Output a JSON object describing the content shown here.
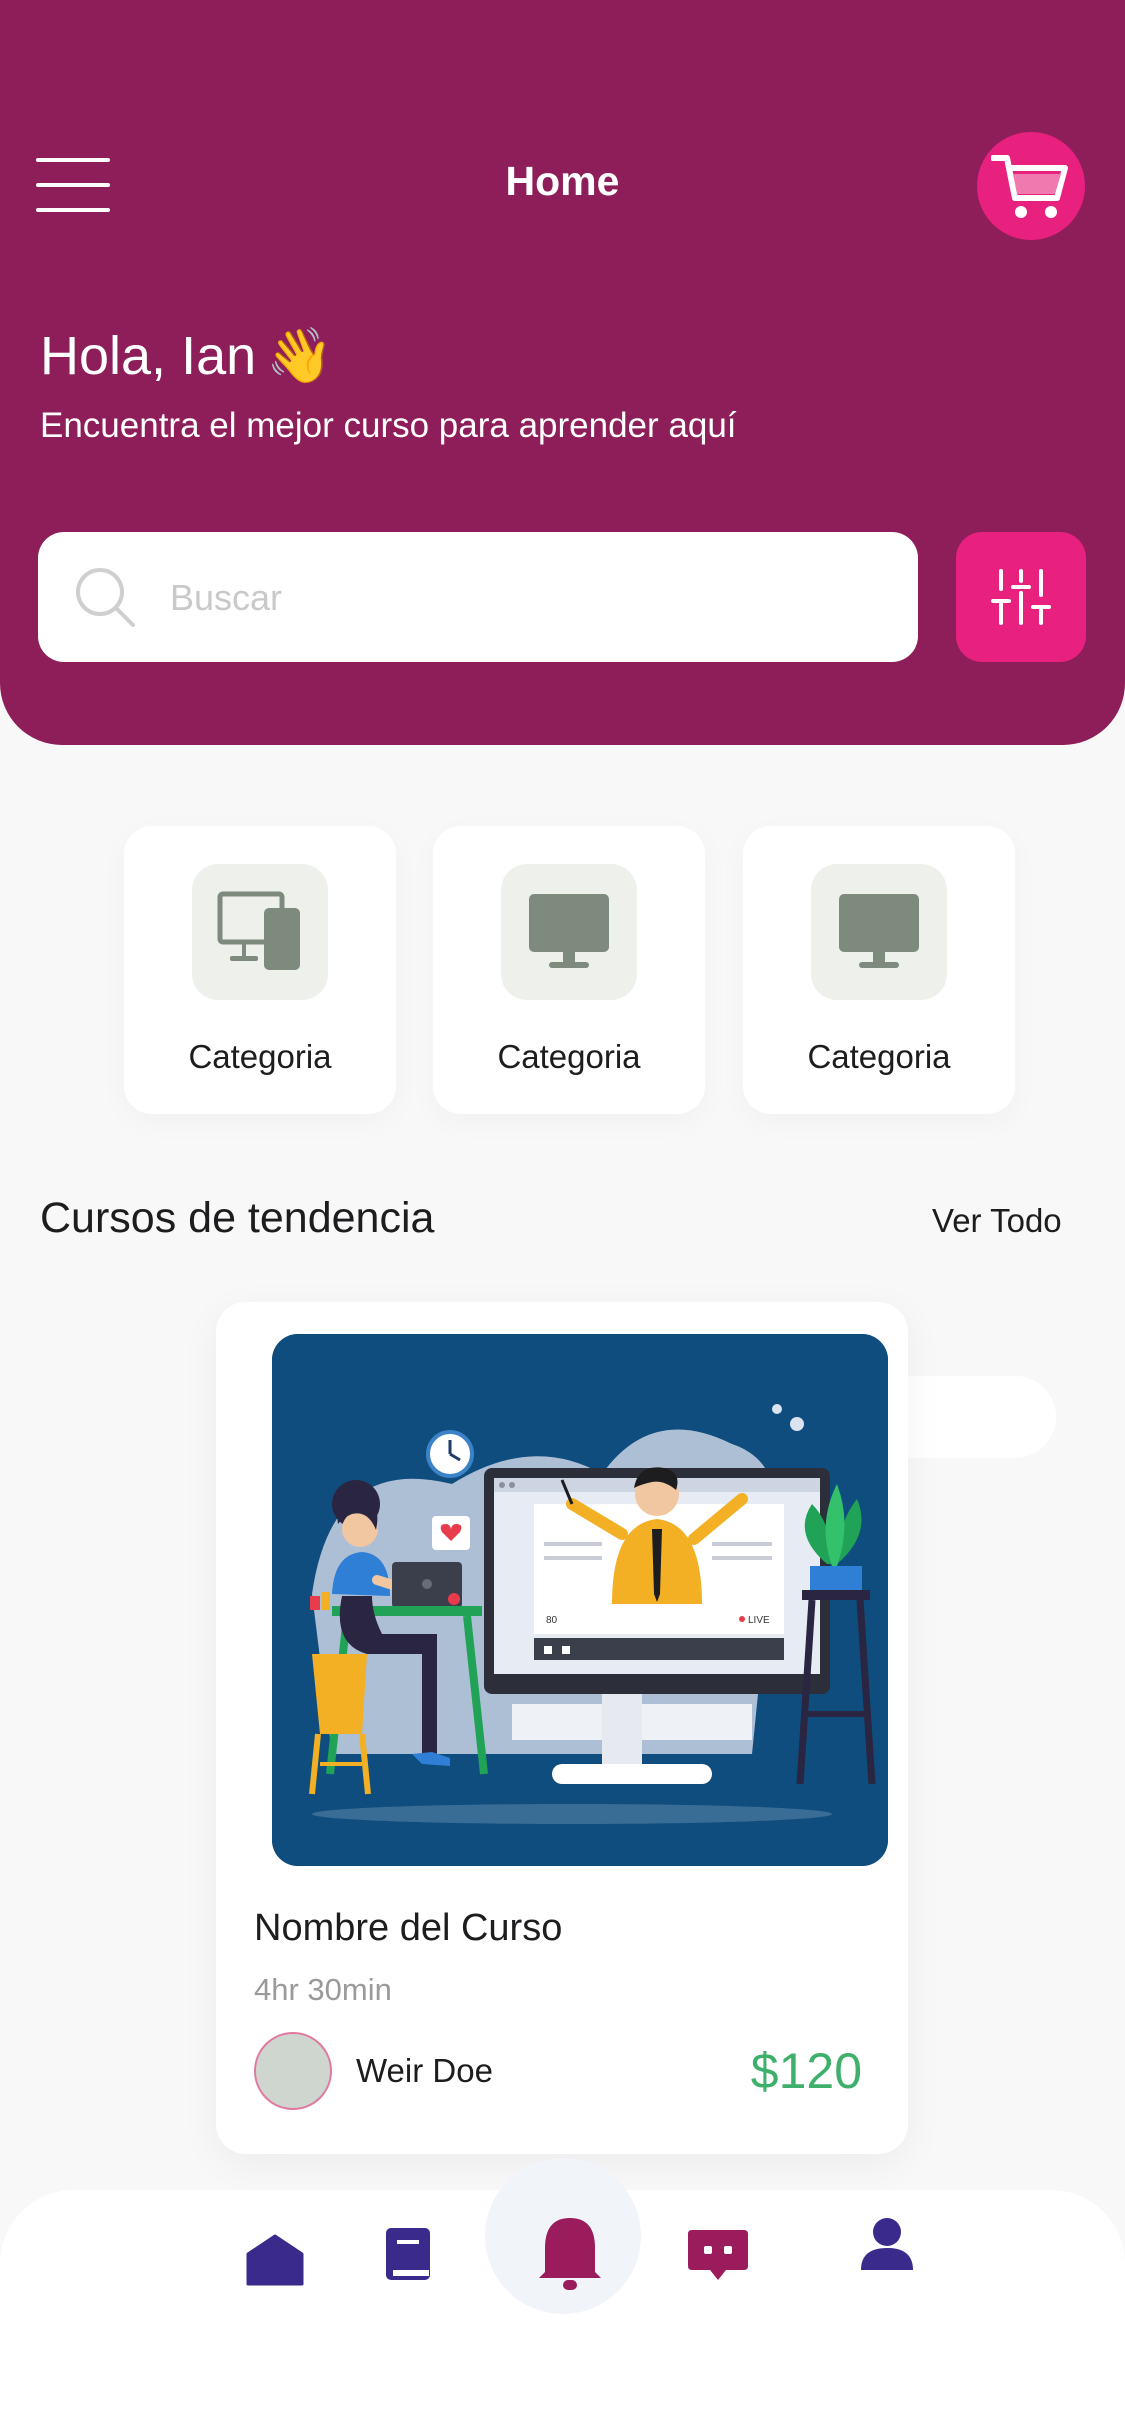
{
  "header": {
    "title": "Home",
    "greeting": "Hola, Ian",
    "wave_emoji": "👋",
    "subtitle": "Encuentra el mejor curso para aprender aquí",
    "background_color": "#8e1e5a"
  },
  "search": {
    "placeholder": "Buscar"
  },
  "categories": [
    {
      "label": "Categoria",
      "icon": "devices-icon"
    },
    {
      "label": "Categoria",
      "icon": "monitor-icon"
    },
    {
      "label": "Categoria",
      "icon": "monitor-icon"
    }
  ],
  "trending": {
    "title": "Cursos de tendencia",
    "see_all": "Ver Todo"
  },
  "course": {
    "name": "Nombre del Curso",
    "duration": "4hr 30min",
    "instructor": "Weir Doe",
    "price": "$120",
    "illustration_badges": {
      "viewers": "80",
      "live": "LIVE"
    }
  },
  "bottom_nav": {
    "items": [
      "home-icon",
      "book-icon",
      "bell-icon",
      "chat-icon",
      "profile-icon"
    ],
    "active": "bell-icon"
  },
  "colors": {
    "accent": "#e8207e",
    "price": "#3fb06c",
    "nav_blue": "#3a2a8c",
    "nav_magenta": "#9a1c5c"
  }
}
